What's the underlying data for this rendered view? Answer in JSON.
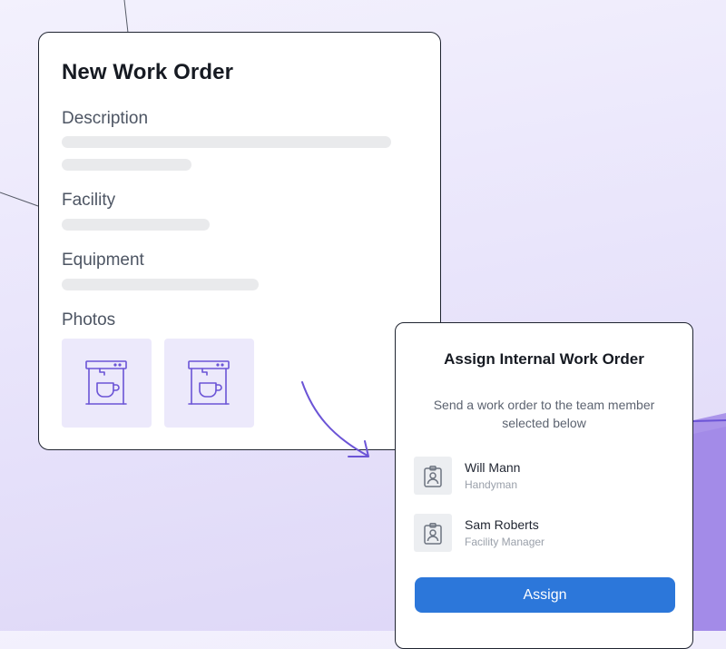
{
  "colors": {
    "accent_purple": "#6b54d6",
    "assign_button": "#2c77da",
    "photo_tile_bg": "#ece9fb",
    "skeleton": "#e9eaec"
  },
  "work_order": {
    "title": "New Work Order",
    "description_label": "Description",
    "facility_label": "Facility",
    "equipment_label": "Equipment",
    "photos_label": "Photos",
    "photos": [
      {
        "icon": "coffee-machine-icon"
      },
      {
        "icon": "coffee-machine-icon"
      }
    ]
  },
  "assign_modal": {
    "title": "Assign Internal Work Order",
    "description": "Send a work order to the team member selected below",
    "members": [
      {
        "name": "Will Mann",
        "role": "Handyman",
        "icon": "id-badge-icon"
      },
      {
        "name": "Sam Roberts",
        "role": "Facility Manager",
        "icon": "id-badge-icon"
      }
    ],
    "button_label": "Assign"
  }
}
